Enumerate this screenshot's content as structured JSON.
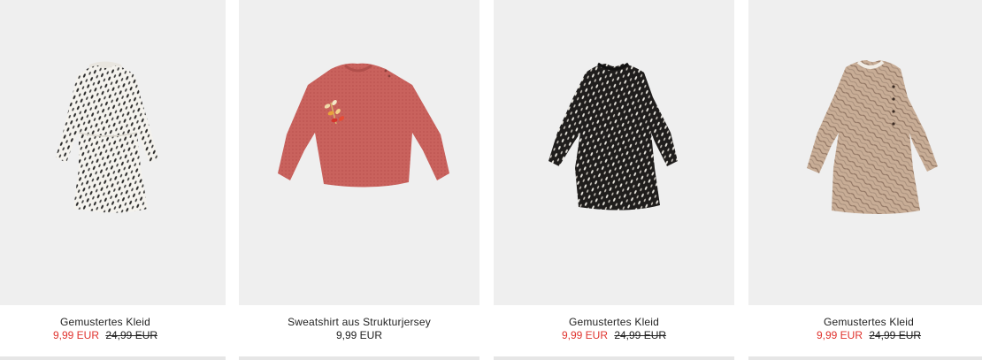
{
  "colors": {
    "sale_price": "#e0332e",
    "text": "#222222",
    "image_bg": "#efefef"
  },
  "products": [
    {
      "name": "Gemustertes Kleid",
      "price": "9,99 EUR",
      "old_price": "24,99 EUR",
      "on_sale": true,
      "image_icon": "white-patterned-dress-image"
    },
    {
      "name": "Sweatshirt aus Strukturjersey",
      "price": "9,99 EUR",
      "old_price": "",
      "on_sale": false,
      "image_icon": "pink-sweatshirt-image"
    },
    {
      "name": "Gemustertes Kleid",
      "price": "9,99 EUR",
      "old_price": "24,99 EUR",
      "on_sale": true,
      "image_icon": "black-patterned-dress-image"
    },
    {
      "name": "Gemustertes Kleid",
      "price": "9,99 EUR",
      "old_price": "24,99 EUR",
      "on_sale": true,
      "image_icon": "beige-patterned-dress-image"
    }
  ]
}
